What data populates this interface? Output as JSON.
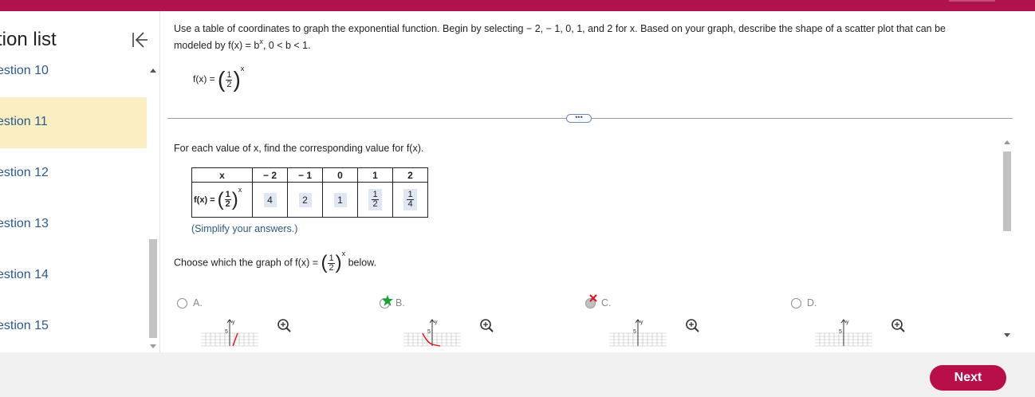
{
  "sidebar": {
    "title": "tion list",
    "items": [
      {
        "label": "estion 10"
      },
      {
        "label": "estion 11"
      },
      {
        "label": "estion 12"
      },
      {
        "label": "estion 13"
      },
      {
        "label": "estion 14"
      },
      {
        "label": "estion 15"
      }
    ]
  },
  "prompt": {
    "line1": "Use a table of coordinates to graph the exponential function. Begin by selecting − 2, − 1, 0, 1, and 2 for x. Based on your graph, describe the shape of a scatter plot that can be",
    "line2_pre": "modeled by f(x) = b",
    "line2_sup": "x",
    "line2_post": ", 0 < b < 1."
  },
  "function": {
    "lhs": "f(x) =",
    "num": "1",
    "den": "2",
    "exp": "x"
  },
  "instruction": "For each value of x, find the corresponding value for f(x).",
  "table": {
    "x_header": "x",
    "x_values": [
      "− 2",
      "− 1",
      "0",
      "1",
      "2"
    ],
    "fx_label": "f(x) =",
    "answers": [
      {
        "whole": "4"
      },
      {
        "whole": "2"
      },
      {
        "whole": "1"
      },
      {
        "num": "1",
        "den": "2"
      },
      {
        "num": "1",
        "den": "4"
      }
    ]
  },
  "hint": "(Simplify your answers.)",
  "choose": {
    "pre": "Choose which the graph of f(x) =",
    "post": "below."
  },
  "choices": [
    {
      "label": "A.",
      "tick": "5",
      "axis": "y"
    },
    {
      "label": "B.",
      "tick": "5",
      "axis": "y"
    },
    {
      "label": "C.",
      "tick": "5",
      "axis": "y"
    },
    {
      "label": "D.",
      "tick": "5",
      "axis": "y"
    }
  ],
  "ellipsis": "•••",
  "footer": {
    "next_label": "Next"
  },
  "colors": {
    "brand": "#b0124b",
    "next": "#b80f4a",
    "active_item": "#faeec2",
    "link": "#2a5a8a",
    "correct": "#1aa339",
    "wrong": "#d9141c"
  }
}
